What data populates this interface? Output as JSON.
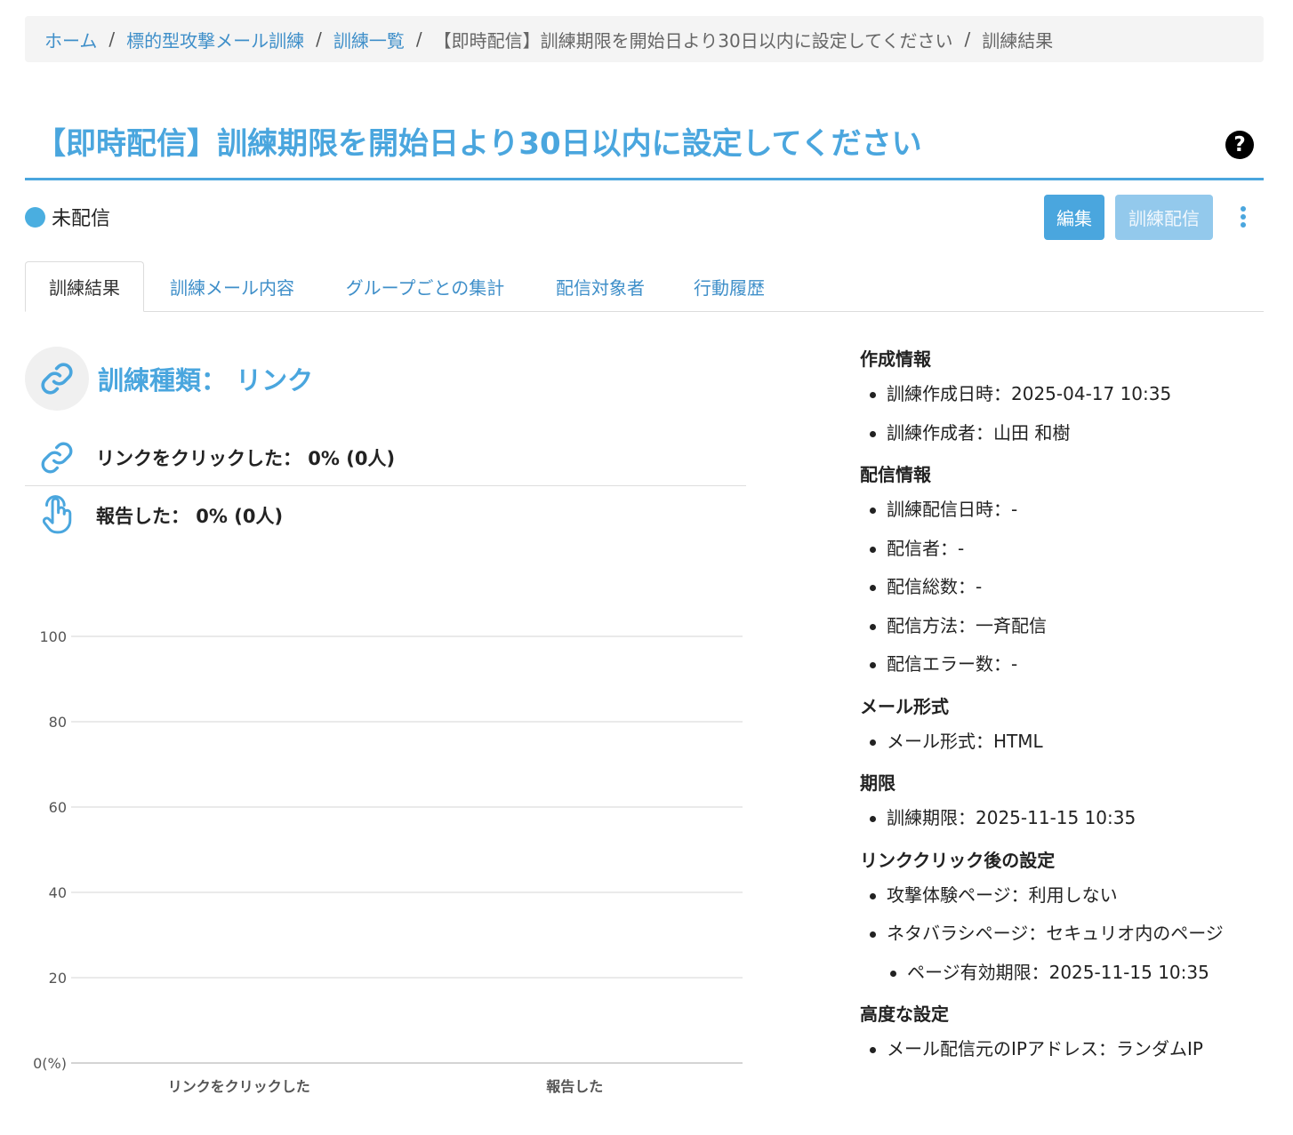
{
  "breadcrumb": {
    "home": "ホーム",
    "training_type": "標的型攻撃メール訓練",
    "training_list": "訓練一覧",
    "training_name": "【即時配信】訓練期限を開始日より30日以内に設定してください",
    "current": "訓練結果",
    "separator": "/"
  },
  "page": {
    "title": "【即時配信】訓練期限を開始日より30日以内に設定してください",
    "help_icon": "?"
  },
  "status": {
    "label": "未配信",
    "color": "#4aaee0"
  },
  "actions": {
    "edit": "編集",
    "send": "訓練配信"
  },
  "tabs": [
    {
      "label": "訓練結果",
      "active": true
    },
    {
      "label": "訓練メール内容",
      "active": false
    },
    {
      "label": "グループごとの集計",
      "active": false
    },
    {
      "label": "配信対象者",
      "active": false
    },
    {
      "label": "行動履歴",
      "active": false
    }
  ],
  "training_type": {
    "heading": "訓練種類： リンク",
    "icon": "link-icon"
  },
  "stats": [
    {
      "label": "リンクをクリックした： 0% (0人)",
      "icon": "link-icon"
    },
    {
      "label": "報告した： 0% (0人)",
      "icon": "hand-tap-icon"
    }
  ],
  "chart_data": {
    "type": "bar",
    "categories": [
      "リンクをクリックした",
      "報告した"
    ],
    "values": [
      0,
      0
    ],
    "ylim": [
      0,
      100
    ],
    "yticks": [
      "0(%)",
      "20",
      "40",
      "60",
      "80",
      "100"
    ],
    "grid": true
  },
  "info": {
    "sections": [
      {
        "heading": "作成情報",
        "items": [
          {
            "text": "訓練作成日時：2025-04-17 10:35"
          },
          {
            "text": "訓練作成者：山田 和樹"
          }
        ]
      },
      {
        "heading": "配信情報",
        "items": [
          {
            "text": "訓練配信日時：-"
          },
          {
            "text": "配信者：-"
          },
          {
            "text": "配信総数：-"
          },
          {
            "text": "配信方法：一斉配信"
          },
          {
            "text": "配信エラー数：-"
          }
        ]
      },
      {
        "heading": "メール形式",
        "items": [
          {
            "text": "メール形式：HTML"
          }
        ]
      },
      {
        "heading": "期限",
        "items": [
          {
            "text": "訓練期限：2025-11-15 10:35"
          }
        ]
      },
      {
        "heading": "リンククリック後の設定",
        "items": [
          {
            "text": "攻撃体験ページ：利用しない"
          },
          {
            "text": "ネタバラシページ：セキュリオ内のページ"
          },
          {
            "text": "ページ有効期限：2025-11-15 10:35",
            "sub": true
          }
        ]
      },
      {
        "heading": "高度な設定",
        "items": [
          {
            "text": "メール配信元のIPアドレス：ランダムIP"
          }
        ]
      }
    ]
  },
  "colors": {
    "accent": "#4aa6de",
    "link": "#3f8fc9"
  }
}
